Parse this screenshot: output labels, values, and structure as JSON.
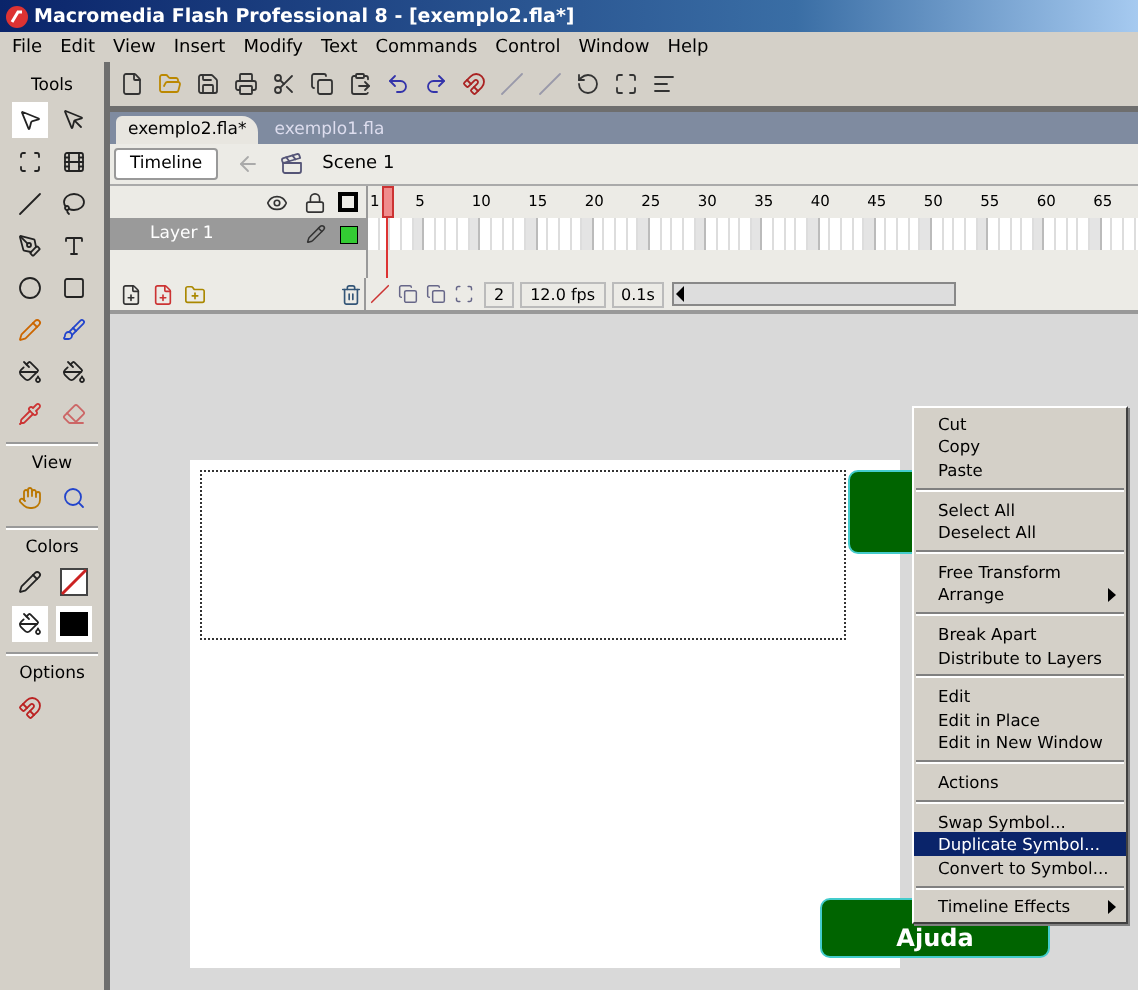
{
  "window": {
    "title": "Macromedia Flash Professional 8 - [exemplo2.fla*]"
  },
  "menu_bar": [
    "File",
    "Edit",
    "View",
    "Insert",
    "Modify",
    "Text",
    "Commands",
    "Control",
    "Window",
    "Help"
  ],
  "tools_panel": {
    "sections": [
      "Tools",
      "View",
      "Colors",
      "Options"
    ]
  },
  "document_tabs": [
    {
      "label": "exemplo2.fla*",
      "selected": true
    },
    {
      "label": "exemplo1.fla",
      "selected": false
    }
  ],
  "edit_bar": {
    "timeline_button": "Timeline",
    "scene": "Scene 1"
  },
  "timeline": {
    "frame_numbers": [
      "1",
      "5",
      "10",
      "15",
      "20",
      "25",
      "30",
      "35",
      "40",
      "45",
      "50",
      "55",
      "60",
      "65"
    ],
    "layers": [
      {
        "name": "Layer 1",
        "selected": true
      }
    ],
    "current_frame": "2",
    "frame_rate": "12.0 fps",
    "elapsed_time": "0.1s"
  },
  "stage": {
    "button_label": "Ajuda"
  },
  "context_menu": {
    "groups": [
      [
        {
          "label": "Cut",
          "selected": false,
          "submenu": false
        },
        {
          "label": "Copy",
          "selected": false,
          "submenu": false
        },
        {
          "label": "Paste",
          "selected": false,
          "submenu": false
        }
      ],
      [
        {
          "label": "Select All",
          "selected": false,
          "submenu": false
        },
        {
          "label": "Deselect All",
          "selected": false,
          "submenu": false
        }
      ],
      [
        {
          "label": "Free Transform",
          "selected": false,
          "submenu": false
        },
        {
          "label": "Arrange",
          "selected": false,
          "submenu": true
        }
      ],
      [
        {
          "label": "Break Apart",
          "selected": false,
          "submenu": false
        },
        {
          "label": "Distribute to Layers",
          "selected": false,
          "submenu": false
        }
      ],
      [
        {
          "label": "Edit",
          "selected": false,
          "submenu": false
        },
        {
          "label": "Edit in Place",
          "selected": false,
          "submenu": false
        },
        {
          "label": "Edit in New Window",
          "selected": false,
          "submenu": false
        }
      ],
      [
        {
          "label": "Actions",
          "selected": false,
          "submenu": false
        }
      ],
      [
        {
          "label": "Swap Symbol...",
          "selected": false,
          "submenu": false
        },
        {
          "label": "Duplicate Symbol...",
          "selected": true,
          "submenu": false
        },
        {
          "label": "Convert to Symbol...",
          "selected": false,
          "submenu": false
        }
      ],
      [
        {
          "label": "Timeline Effects",
          "selected": false,
          "submenu": true
        }
      ]
    ]
  }
}
